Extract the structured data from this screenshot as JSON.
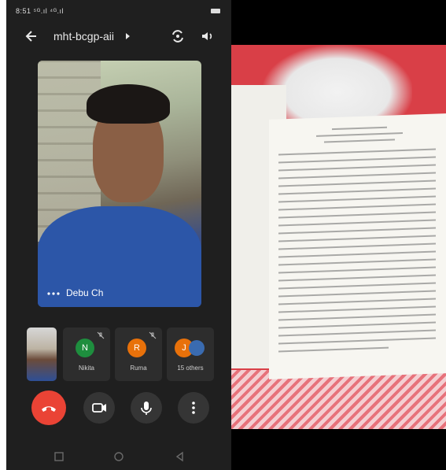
{
  "status_bar": {
    "time": "8:51 ⁵ᴳ.ıl ⁴ᴳ.ıl"
  },
  "header": {
    "meeting_code": "mht-bcgp-aii"
  },
  "main_tile": {
    "participant_name": "Debu Ch"
  },
  "participants": [
    {
      "initial": "N",
      "name": "Nikita",
      "color": "#1e8e3e",
      "muted": true
    },
    {
      "initial": "R",
      "name": "Ruma",
      "color": "#e8710a",
      "muted": true
    },
    {
      "initial": "J",
      "name": "15 others",
      "color": "#e8710a",
      "muted": false
    }
  ],
  "colors": {
    "end_call": "#ea4335",
    "background": "#1f1f1f"
  },
  "icons": {
    "back": "back-arrow-icon",
    "switch_camera": "switch-camera-icon",
    "speaker": "speaker-icon",
    "end_call": "phone-hangup-icon",
    "camera": "video-camera-icon",
    "mic": "microphone-icon",
    "more": "more-vert-icon"
  }
}
